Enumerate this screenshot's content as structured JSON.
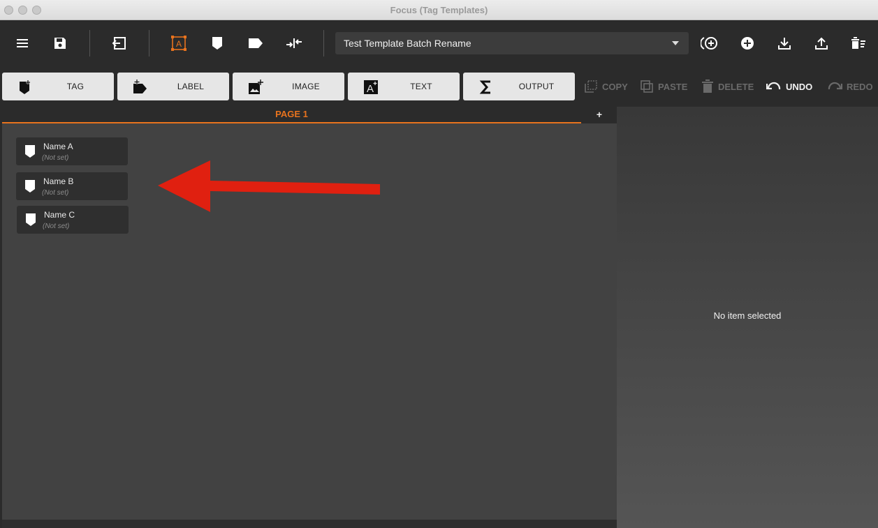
{
  "window": {
    "title": "Focus (Tag Templates)"
  },
  "toolbar": {
    "template_name": "Test Template Batch Rename",
    "accent_color": "#e8731e"
  },
  "add_buttons": {
    "tag": "TAG",
    "label": "LABEL",
    "image": "IMAGE",
    "text": "TEXT",
    "output": "OUTPUT"
  },
  "actions": {
    "copy": "COPY",
    "paste": "PASTE",
    "delete": "DELETE",
    "undo": "UNDO",
    "redo": "REDO"
  },
  "tabs": {
    "page1": "PAGE 1",
    "add": "+"
  },
  "items": [
    {
      "name": "Name A",
      "value": "(Not set)"
    },
    {
      "name": "Name B",
      "value": "(Not set)"
    },
    {
      "name": "Name C",
      "value": "(Not set)"
    }
  ],
  "panel": {
    "empty_text": "No item selected"
  },
  "annotation": {
    "color": "#e02010"
  }
}
